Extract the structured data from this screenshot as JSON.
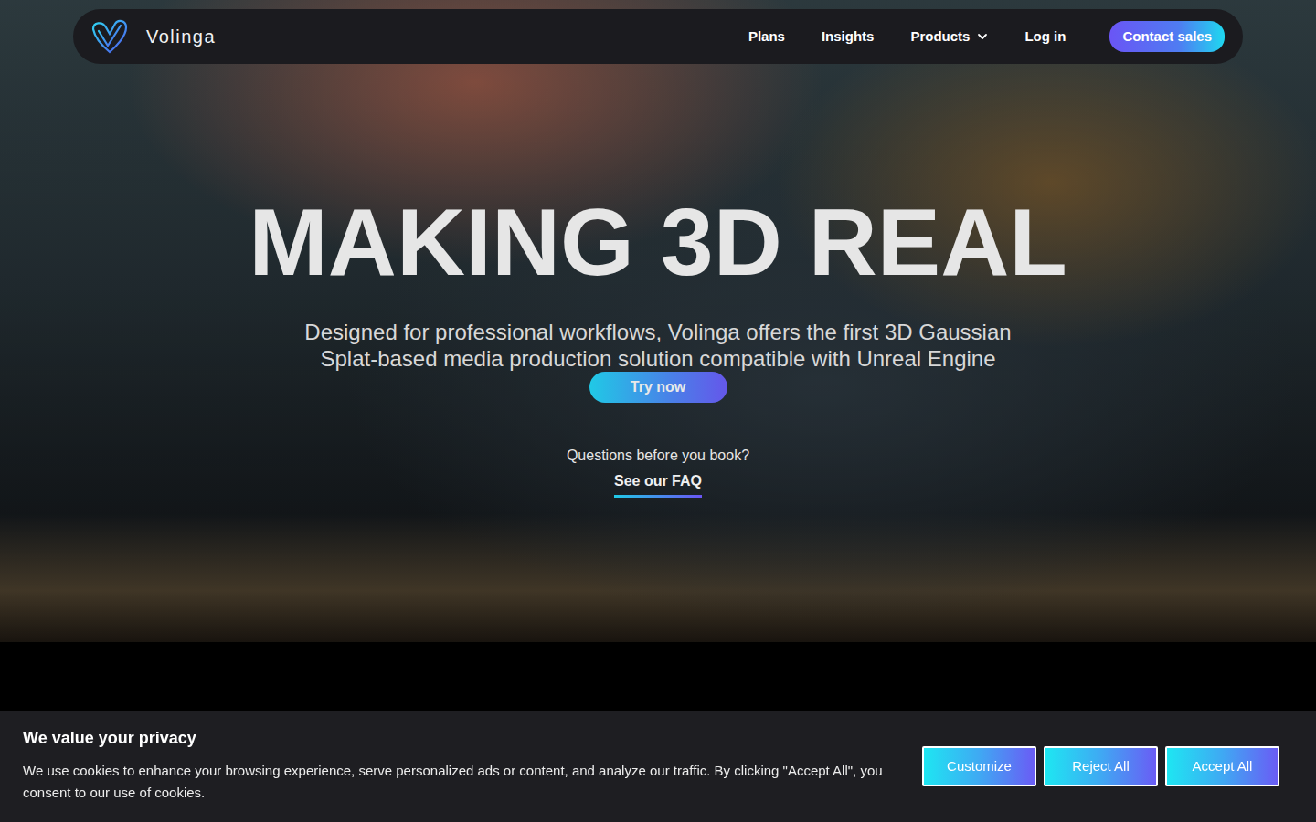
{
  "nav": {
    "brand": "Volinga",
    "links": [
      {
        "label": "Plans",
        "kind": "link"
      },
      {
        "label": "Insights",
        "kind": "link"
      },
      {
        "label": "Products",
        "kind": "dropdown"
      },
      {
        "label": "Log in",
        "kind": "link"
      }
    ],
    "cta": "Contact sales"
  },
  "hero": {
    "title": "MAKING 3D REAL",
    "subtitle": "Designed for professional workflows, Volinga offers the first 3D Gaussian Splat-based media production solution compatible with Unreal Engine",
    "button": "Try now",
    "faq_prompt": "Questions before you book?",
    "faq_link": "See our FAQ"
  },
  "cookie_banner": {
    "title": "We value your privacy",
    "text": "We use cookies to enhance your browsing experience, serve personalized ads or content, and analyze our traffic. By clicking \"Accept All\", you consent to our use of cookies.",
    "buttons": [
      "Customize",
      "Reject All",
      "Accept All"
    ]
  }
}
